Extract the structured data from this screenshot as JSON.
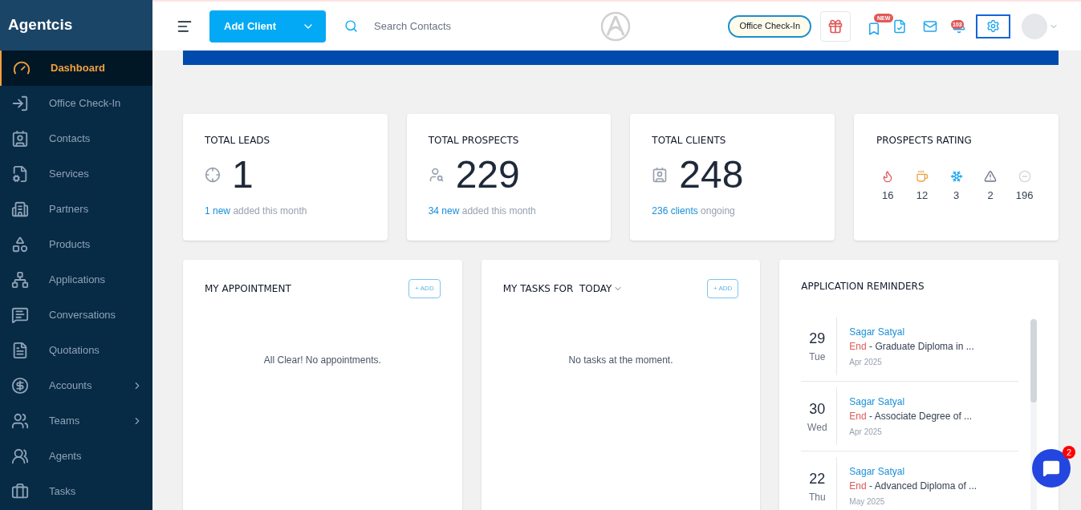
{
  "brand": "Agentcis",
  "sidebar": {
    "items": [
      {
        "label": "Dashboard",
        "selected": true,
        "expandable": false
      },
      {
        "label": "Office Check-In",
        "selected": false,
        "expandable": false
      },
      {
        "label": "Contacts",
        "selected": false,
        "expandable": false
      },
      {
        "label": "Services",
        "selected": false,
        "expandable": false
      },
      {
        "label": "Partners",
        "selected": false,
        "expandable": false
      },
      {
        "label": "Products",
        "selected": false,
        "expandable": false
      },
      {
        "label": "Applications",
        "selected": false,
        "expandable": false
      },
      {
        "label": "Conversations",
        "selected": false,
        "expandable": false
      },
      {
        "label": "Quotations",
        "selected": false,
        "expandable": false
      },
      {
        "label": "Accounts",
        "selected": false,
        "expandable": true
      },
      {
        "label": "Teams",
        "selected": false,
        "expandable": true
      },
      {
        "label": "Agents",
        "selected": false,
        "expandable": false
      },
      {
        "label": "Tasks",
        "selected": false,
        "expandable": false
      }
    ]
  },
  "topbar": {
    "add_button": "Add Client",
    "search": {
      "placeholder": "Search Contacts"
    },
    "checkin_button": "Office Check-In",
    "new_badge": "NEW",
    "notification_count": "103",
    "settings_selected": true
  },
  "stats": [
    {
      "title": "TOTAL LEADS",
      "value": "1",
      "kind": "leads",
      "link": "1 new",
      "note": "added this month"
    },
    {
      "title": "TOTAL PROSPECTS",
      "value": "229",
      "kind": "prospects",
      "link": "34 new",
      "note": "added this month"
    },
    {
      "title": "TOTAL CLIENTS",
      "value": "248",
      "kind": "clients",
      "link": "236 clients",
      "note": "ongoing"
    }
  ],
  "rating": {
    "title": "PROSPECTS RATING",
    "items": [
      {
        "kind": "hot",
        "count": "16"
      },
      {
        "kind": "warm",
        "count": "12"
      },
      {
        "kind": "cold",
        "count": "3"
      },
      {
        "kind": "warning",
        "count": "2"
      },
      {
        "kind": "none",
        "count": "196"
      }
    ]
  },
  "appointments": {
    "title": "MY APPOINTMENT",
    "add": "+ ADD",
    "empty": "All Clear! No appointments."
  },
  "tasks": {
    "title": "MY TASKS FOR  TODAY",
    "add": "+ ADD",
    "empty": "No tasks at the moment."
  },
  "reminders": {
    "title": "APPLICATION REMINDERS",
    "items": [
      {
        "day": "29",
        "weekday": "Tue",
        "name": "Sagar Satyal",
        "status": "End",
        "course": "- Graduate Diploma in ...",
        "month": "Apr 2025"
      },
      {
        "day": "30",
        "weekday": "Wed",
        "name": "Sagar Satyal",
        "status": "End",
        "course": "- Associate Degree of ...",
        "month": "Apr 2025"
      },
      {
        "day": "22",
        "weekday": "Thu",
        "name": "Sagar Satyal",
        "status": "End",
        "course": "- Advanced Diploma of ...",
        "month": "May 2025"
      }
    ]
  },
  "chat_badge": "2"
}
